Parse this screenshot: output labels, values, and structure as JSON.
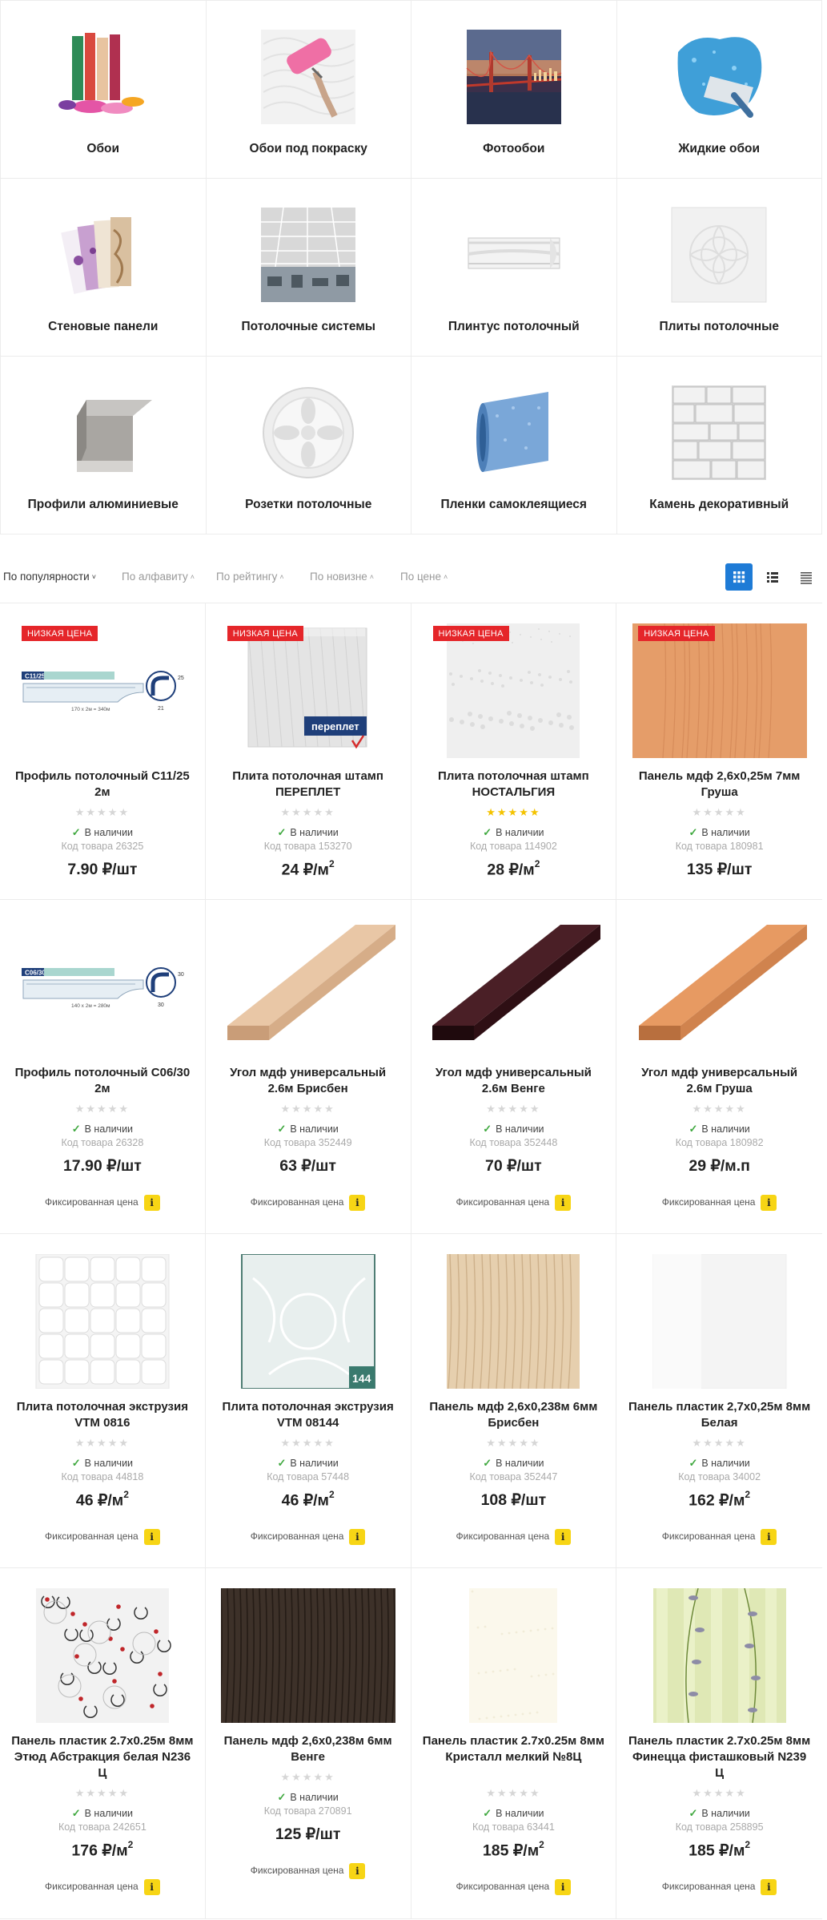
{
  "categories": [
    {
      "label": "Обои",
      "icon": "wallpaper-rolls-image"
    },
    {
      "label": "Обои под покраску",
      "icon": "paint-roller-image"
    },
    {
      "label": "Фотообои",
      "icon": "bridge-photo-image"
    },
    {
      "label": "Жидкие обои",
      "icon": "liquid-wallpaper-trowel-image"
    },
    {
      "label": "Стеновые панели",
      "icon": "wall-panels-image"
    },
    {
      "label": "Потолочные системы",
      "icon": "ceiling-system-image"
    },
    {
      "label": "Плинтус потолочный",
      "icon": "ceiling-baseboard-image"
    },
    {
      "label": "Плиты потолочные",
      "icon": "ceiling-tile-image"
    },
    {
      "label": "Профили алюминиевые",
      "icon": "aluminium-angle-image"
    },
    {
      "label": "Розетки потолочные",
      "icon": "ceiling-rosette-image"
    },
    {
      "label": "Пленки самоклеящиеся",
      "icon": "adhesive-film-roll-image"
    },
    {
      "label": "Камень декоративный",
      "icon": "decorative-stone-image"
    }
  ],
  "sort": {
    "items": [
      {
        "label": "По популярности",
        "chevron": "˅",
        "active": true
      },
      {
        "label": "По алфавиту",
        "chevron": "˄",
        "active": false
      },
      {
        "label": "По рейтингу",
        "chevron": "˄",
        "active": false
      },
      {
        "label": "По новизне",
        "chevron": "˄",
        "active": false
      },
      {
        "label": "По цене",
        "chevron": "˄",
        "active": false
      }
    ]
  },
  "products": [
    {
      "badge": "НИЗКАЯ ЦЕНА",
      "title": "Профиль потолочный С11/25 2м",
      "rating": 0,
      "stock": "В наличии",
      "sku": "Код товара 26325",
      "price": "7.90 ₽/шт",
      "sup": "",
      "fixed": "",
      "img": "profile-c11",
      "img_text": "C11/25",
      "img_caption": "170 x 2м = 340м",
      "img_num": "25",
      "img_num2": "21"
    },
    {
      "badge": "НИЗКАЯ ЦЕНА",
      "title": "Плита потолочная штамп ПЕРЕПЛЕТ",
      "rating": 0,
      "stock": "В наличии",
      "sku": "Код товара 153270",
      "price": "24 ₽/м",
      "sup": "2",
      "fixed": "",
      "img": "tile-pereplet",
      "img_text": "переплет"
    },
    {
      "badge": "НИЗКАЯ ЦЕНА",
      "title": "Плита потолочная штамп НОСТАЛЬГИЯ",
      "rating": 5,
      "stock": "В наличии",
      "sku": "Код товара 114902",
      "price": "28 ₽/м",
      "sup": "2",
      "fixed": "",
      "img": "tile-nostalgia"
    },
    {
      "badge": "НИЗКАЯ ЦЕНА",
      "title": "Панель мдф 2,6х0,25м 7мм Груша",
      "rating": 0,
      "stock": "В наличии",
      "sku": "Код товара 180981",
      "price": "135 ₽/шт",
      "sup": "",
      "fixed": "",
      "img": "mdf-pear"
    },
    {
      "badge": "",
      "title": "Профиль потолочный С06/30 2м",
      "rating": 0,
      "stock": "В наличии",
      "sku": "Код товара 26328",
      "price": "17.90 ₽/шт",
      "sup": "",
      "fixed": "Фиксированная цена",
      "img": "profile-c06",
      "img_text": "C06/30",
      "img_caption": "140 x 2м = 280м",
      "img_num": "30",
      "img_num2": "30"
    },
    {
      "badge": "",
      "title": "Угол мдф универсальный 2.6м Брисбен",
      "rating": 0,
      "stock": "В наличии",
      "sku": "Код товара 352449",
      "price": "63 ₽/шт",
      "sup": "",
      "fixed": "Фиксированная цена",
      "img": "angle-brisben"
    },
    {
      "badge": "",
      "title": "Угол мдф универсальный 2.6м Венге",
      "rating": 0,
      "stock": "В наличии",
      "sku": "Код товара 352448",
      "price": "70 ₽/шт",
      "sup": "",
      "fixed": "Фиксированная цена",
      "img": "angle-wenge"
    },
    {
      "badge": "",
      "title": "Угол мдф универсальный 2.6м Груша",
      "rating": 0,
      "stock": "В наличии",
      "sku": "Код товара 180982",
      "price": "29 ₽/м.п",
      "sup": "",
      "fixed": "Фиксированная цена",
      "img": "angle-pear"
    },
    {
      "badge": "",
      "title": "Плита потолочная экструзия VTM 0816",
      "rating": 0,
      "stock": "В наличии",
      "sku": "Код товара 44818",
      "price": "46 ₽/м",
      "sup": "2",
      "fixed": "Фиксированная цена",
      "img": "tile-vtm0816"
    },
    {
      "badge": "",
      "title": "Плита потолочная экструзия VTM 08144",
      "rating": 0,
      "stock": "В наличии",
      "sku": "Код товара 57448",
      "price": "46 ₽/м",
      "sup": "2",
      "fixed": "Фиксированная цена",
      "img": "tile-vtm08144",
      "img_text": "144"
    },
    {
      "badge": "",
      "title": "Панель мдф 2,6х0,238м 6мм Брисбен",
      "rating": 0,
      "stock": "В наличии",
      "sku": "Код товара 352447",
      "price": "108 ₽/шт",
      "sup": "",
      "fixed": "Фиксированная цена",
      "img": "mdf-brisben"
    },
    {
      "badge": "",
      "title": "Панель пластик 2,7х0,25м 8мм Белая",
      "rating": 0,
      "stock": "В наличии",
      "sku": "Код товара 34002",
      "price": "162 ₽/м",
      "sup": "2",
      "fixed": "Фиксированная цена",
      "img": "plastic-white"
    },
    {
      "badge": "",
      "title": "Панель пластик 2.7х0.25м 8мм Этюд Абстракция белая N236 Ц",
      "rating": 0,
      "stock": "В наличии",
      "sku": "Код товара 242651",
      "price": "176 ₽/м",
      "sup": "2",
      "fixed": "Фиксированная цена",
      "img": "plastic-etude"
    },
    {
      "badge": "",
      "title": "Панель мдф 2,6х0,238м 6мм Венге",
      "rating": 0,
      "stock": "В наличии",
      "sku": "Код товара 270891",
      "price": "125 ₽/шт",
      "sup": "",
      "fixed": "Фиксированная цена",
      "img": "mdf-wenge"
    },
    {
      "badge": "",
      "title": "Панель пластик 2.7х0.25м 8мм Кристалл мелкий №8Ц",
      "rating": 0,
      "stock": "В наличии",
      "sku": "Код товара 63441",
      "price": "185 ₽/м",
      "sup": "2",
      "fixed": "Фиксированная цена",
      "img": "plastic-crystal"
    },
    {
      "badge": "",
      "title": "Панель пластик 2.7х0.25м 8мм Финецца фисташковый N239 Ц",
      "rating": 0,
      "stock": "В наличии",
      "sku": "Код товара 258895",
      "price": "185 ₽/м",
      "sup": "2",
      "fixed": "Фиксированная цена",
      "img": "plastic-finezza"
    }
  ],
  "colors": {
    "accent": "#1e7bd6",
    "badge": "#e5262a",
    "star": "#f4c300",
    "info": "#f7d515",
    "stock_tick": "#3fa83f"
  }
}
